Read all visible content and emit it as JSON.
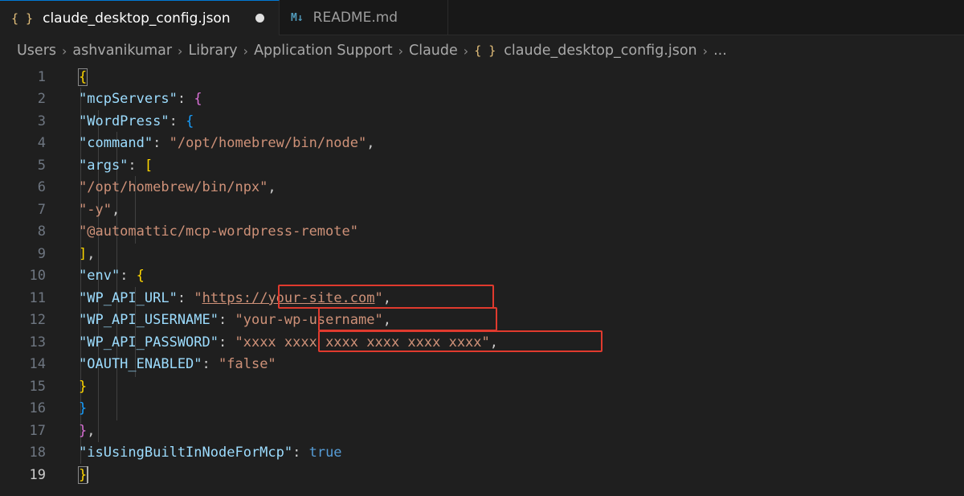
{
  "tabs": [
    {
      "icon": "{ }",
      "label": "claude_desktop_config.json",
      "active": true,
      "dirty": true
    },
    {
      "icon": "M↓",
      "label": "README.md",
      "active": false,
      "dirty": false
    }
  ],
  "breadcrumb": [
    "Users",
    "ashvanikumar",
    "Library",
    "Application Support",
    "Claude",
    "claude_desktop_config.json",
    "..."
  ],
  "breadcrumb_file_icon": "{ }",
  "line_numbers": [
    "1",
    "2",
    "3",
    "4",
    "5",
    "6",
    "7",
    "8",
    "9",
    "10",
    "11",
    "12",
    "13",
    "14",
    "15",
    "16",
    "17",
    "18",
    "19"
  ],
  "code": {
    "mcpServers_key": "\"mcpServers\"",
    "wordpress_key": "\"WordPress\"",
    "command_key": "\"command\"",
    "command_value": "\"/opt/homebrew/bin/node\"",
    "args_key": "\"args\"",
    "args": [
      "\"/opt/homebrew/bin/npx\"",
      "\"-y\"",
      "\"@automattic/mcp-wordpress-remote\""
    ],
    "env_key": "\"env\"",
    "wp_api_url_key": "\"WP_API_URL\"",
    "wp_api_url_value": "https://your-site.com",
    "wp_api_username_key": "\"WP_API_USERNAME\"",
    "wp_api_username_value": "\"your-wp-username\"",
    "wp_api_password_key": "\"WP_API_PASSWORD\"",
    "wp_api_password_value": "\"xxxx xxxx xxxx xxxx xxxx xxxx\"",
    "oauth_key": "\"OAUTH_ENABLED\"",
    "oauth_value": "\"false\"",
    "builtin_key": "\"isUsingBuiltInNodeForMcp\"",
    "builtin_value": "true"
  },
  "colors": {
    "background": "#1f1f1f",
    "key": "#9cdcfe",
    "string": "#ce9178",
    "bracket_level1": "#ffd700",
    "bracket_level2": "#da70d6",
    "bracket_level3": "#179fff",
    "keyword": "#569cd6",
    "highlight_box": "#e03a2e"
  }
}
